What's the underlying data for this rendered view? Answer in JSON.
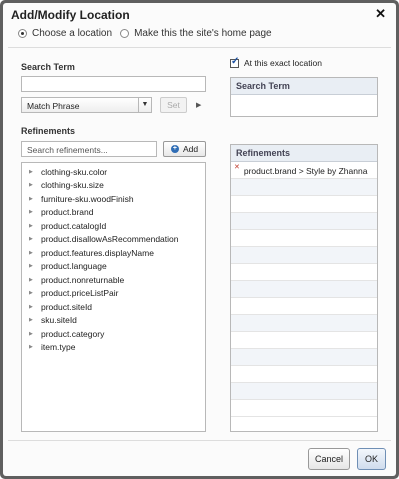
{
  "dialog": {
    "title": "Add/Modify Location"
  },
  "mode": {
    "option1": "Choose a location",
    "option2": "Make this the site's home page",
    "selected": "option1"
  },
  "left": {
    "search_term_label": "Search Term",
    "search_term_value": "",
    "match_select_value": "Match Phrase",
    "set_label": "Set",
    "refinements_label": "Refinements",
    "search_refinements_placeholder": "Search refinements...",
    "add_label": "Add",
    "tree_items": [
      "clothing-sku.color",
      "clothing-sku.size",
      "furniture-sku.woodFinish",
      "product.brand",
      "product.catalogId",
      "product.disallowAsRecommendation",
      "product.features.displayName",
      "product.language",
      "product.nonreturnable",
      "product.priceListPair",
      "product.siteId",
      "sku.siteId",
      "product.category",
      "item.type"
    ]
  },
  "right": {
    "exact_location_label": "At this exact location",
    "exact_location_checked": true,
    "search_term_header": "Search Term",
    "refinements_header": "Refinements",
    "refinement_entries": [
      "product.brand > Style by Zhanna"
    ]
  },
  "footer": {
    "cancel_label": "Cancel",
    "ok_label": "OK"
  }
}
